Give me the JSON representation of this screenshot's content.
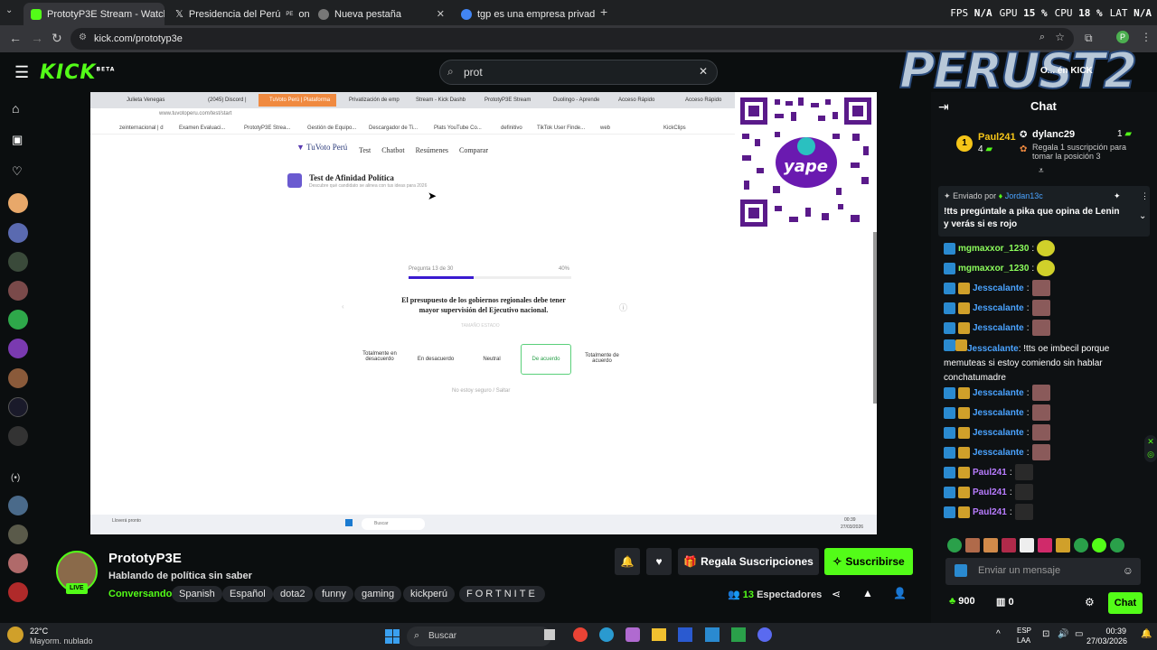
{
  "browser": {
    "tabs": [
      {
        "title": "PrototyP3E Stream - Watch Live",
        "color": "#53fc18"
      },
      {
        "title": "Presidencia del Perú",
        "suffix_small": "PE",
        "title_tail": "on X: \"E",
        "color": "#ffffff"
      },
      {
        "title": "Nueva pestaña",
        "color": "#aaaaaa"
      },
      {
        "title": "tgp es una empresa privada o p",
        "color": "#4285f4"
      }
    ],
    "url": "kick.com/prototyp3e",
    "stats": {
      "fps_label": "FPS",
      "fps": "N/A",
      "gpu_label": "GPU",
      "gpu": "15 %",
      "cpu_label": "CPU",
      "cpu": "18 %",
      "lat_label": "LAT",
      "lat": "N/A"
    }
  },
  "kick": {
    "logo": "KICK",
    "logo_badge": "BETA",
    "search_value": "prot"
  },
  "video": {
    "inner_tabs": [
      "Julieta Venegas",
      "(2045) Discord |",
      "TuVoto Perú | Plataforma",
      "Privatización de emp",
      "Stream - Kick Dashb",
      "PrototyP3E Stream",
      "Duolingo - Aprende",
      "Acceso Rápido",
      "Acceso Rápido"
    ],
    "inner_url": "www.tuvotoperu.com/test/start",
    "bookmarks": [
      "zeinternacional | d",
      "Examen Evaluaci...",
      "PrototyP3E Strea...",
      "Gestión de Equipo...",
      "Descargador de Ti...",
      "Plats YouTube Co...",
      "definitivo",
      "TikTok User Finde...",
      "web",
      "KickClips"
    ],
    "site_nav": [
      "Test",
      "Chatbot",
      "Resúmenes",
      "Comparar"
    ],
    "site_logo": "TuVoto Perú",
    "test_title": "Test de Afinidad Política",
    "test_sub": "Descubre qué candidato se alinea con tus ideas para 2026",
    "progress_label": "Pregunta 13 de 30",
    "progress_pct": "40%",
    "progress_value": 0.4,
    "question": "El presupuesto de los gobiernos regionales debe tener mayor supervisión del Ejecutivo nacional.",
    "question_tag": "TAMAÑO ESTADO",
    "options": [
      "Totalmente en desacuerdo",
      "En desacuerdo",
      "Neutral",
      "De acuerdo",
      "Totalmente de acuerdo"
    ],
    "selected_option": "De acuerdo",
    "skip": "No estoy seguro / Saltar",
    "inner_taskbar_weather": "Lloverá pronto",
    "inner_taskbar_search": "Buscar",
    "inner_clock": "00:39",
    "inner_date": "27/03/2026"
  },
  "overlay": {
    "brand": "PERUST2",
    "brand_tag": "O... én KICK"
  },
  "qr": {
    "label": "yape"
  },
  "channel": {
    "name": "PrototyP3E",
    "live": "LIVE",
    "title": "Hablando de política sin saber",
    "category": "Conversando",
    "tags": [
      "Spanish",
      "Español",
      "dota2",
      "funny",
      "gaming",
      "kickperú",
      "FORTNITE"
    ],
    "gift_button": "Regala Suscripciones",
    "subscribe_button": "Suscribirse",
    "viewers": "13",
    "viewers_label": "Espectadores"
  },
  "chat": {
    "title": "Chat",
    "leaderboard": [
      {
        "rank": "1",
        "user": "Paul241",
        "count": "4"
      },
      {
        "rank": "",
        "user": "dylanc29",
        "count": "1"
      }
    ],
    "leader_hint": "Regala 1 suscripción para tomar la posición 3",
    "pinned_by": "Enviado por",
    "pinned_user": "Jordan13c",
    "pinned_text": "!tts pregúntale a pika que opina de Lenin y verás si es rojo",
    "messages": [
      {
        "user": "mgmaxxor_1230",
        "text": "",
        "cls": "u-green"
      },
      {
        "user": "mgmaxxor_1230",
        "text": "",
        "cls": "u-green"
      },
      {
        "user": "Jesscalante",
        "text": "",
        "cls": "u-blue"
      },
      {
        "user": "Jesscalante",
        "text": "",
        "cls": "u-blue"
      },
      {
        "user": "Jesscalante",
        "text": "",
        "cls": "u-blue"
      },
      {
        "user": "Jesscalante",
        "text": "!tts oe imbecil porque memuteas si estoy comiendo sin hablar conchatumadre",
        "cls": "u-blue"
      },
      {
        "user": "Jesscalante",
        "text": "",
        "cls": "u-blue"
      },
      {
        "user": "Jesscalante",
        "text": "",
        "cls": "u-blue"
      },
      {
        "user": "Jesscalante",
        "text": "",
        "cls": "u-blue"
      },
      {
        "user": "Jesscalante",
        "text": "",
        "cls": "u-blue"
      },
      {
        "user": "Paul241",
        "text": "",
        "cls": "u-purple"
      },
      {
        "user": "Paul241",
        "text": "",
        "cls": "u-purple"
      },
      {
        "user": "Paul241",
        "text": "",
        "cls": "u-purple"
      }
    ],
    "input_placeholder": "Enviar un mensaje",
    "points": "900",
    "gifts": "0",
    "send_button": "Chat"
  },
  "taskbar": {
    "temp": "22°C",
    "weather": "Mayorm. nublado",
    "search": "Buscar",
    "lang": "ESP",
    "lang2": "LAA",
    "time": "00:39",
    "date": "27/03/2026"
  }
}
